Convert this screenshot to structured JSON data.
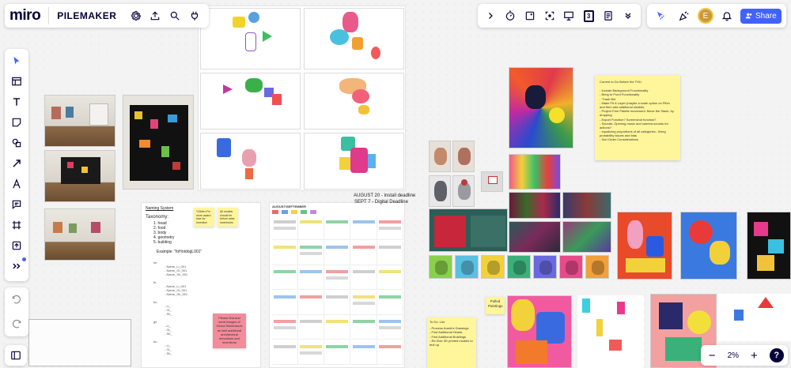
{
  "app": {
    "logo": "miro",
    "board_name": "PILEMAKER",
    "share_label": "Share",
    "avatar_initial": "E",
    "zoom": "2%",
    "help": "?",
    "counter_badge": "3"
  },
  "colors": {
    "accent": "#4262ff",
    "sticky_yellow": "#fff59b",
    "sticky_pink": "#f28b9a",
    "sticky_light": "#fffbe0"
  },
  "icons": {
    "top_left": [
      "gear-icon",
      "upload-icon",
      "search-icon",
      "plug-icon"
    ],
    "top_right": [
      "chevron-right-icon",
      "timer-icon",
      "sticky-icon",
      "focus-icon",
      "present-icon",
      "counter-icon",
      "notes-icon",
      "chevrons-down-icon"
    ],
    "collab": [
      "reaction-icon",
      "celebrate-icon",
      "bell-icon"
    ],
    "left_tools": [
      "select-icon",
      "table-icon",
      "text-icon",
      "sticky-note-icon",
      "shapes-icon",
      "arrow-icon",
      "pen-icon",
      "comment-icon",
      "frame-icon",
      "upload-icon",
      "more-icon"
    ]
  },
  "board": {
    "naming": {
      "title": "Naming System",
      "taxonomy_label": "Taxonomy:",
      "items": [
        "1. head",
        "2. food",
        "3. body",
        "4. geometry",
        "5. building"
      ],
      "example": "Example:  \"foHotdogL001\"",
      "groups": [
        {
          "code": "he",
          "lines": [
            "Name_Li_001",
            "Name_Gi_001",
            "Name_Sh_001"
          ]
        },
        {
          "code": "fo",
          "lines": [
            "Name_Li_001",
            "Name_Gi_001",
            "Name_Sh_001"
          ]
        },
        {
          "code": "bo",
          "lines": [
            "Li_",
            "Gi_",
            "Sh_"
          ]
        },
        {
          "code": "ge",
          "lines": [
            "Li_",
            "Gi_",
            "Sh_"
          ]
        },
        {
          "code": "bu",
          "lines": [
            "Li_",
            "Gi_",
            "Sh_"
          ]
        }
      ],
      "sticky_a": "*Gibber-Fin more award time for Inventive",
      "sticky_b": "All models should be before artist inventories",
      "sticky_pink": "Please find and send images of Gema Sketchbook as well additional architectural elevations and inventions"
    },
    "calendar": {
      "header": "AUGUST/SEPTEMBER",
      "deadline_1": "AUGUST 20 - install deadline",
      "deadline_2": "SEPT 7 - Digital Deadline"
    },
    "sticky_current": {
      "title": "Current to Do Before the THU",
      "lines": [
        "- Include Background Functionality",
        "- Bring to Front Functionality",
        "- 'Trash Bin'",
        "- Make Pit & Layer (maybe a scale option on Pitch and then add additional sizable)",
        "- Project Free Palette movement: Move the Stack, by dropping",
        "- Export Function? Screenshot function?",
        "- Sounds: Opening music and camera sounds for actions?",
        "- equalizing proportions of all categories - fixing probability issues and bias",
        "- Sort Order Considerations"
      ]
    },
    "sticky_pulled": "Pulled Paintings",
    "sticky_todo": {
      "title": "To Do: List",
      "lines": [
        "- Process Austin's Drawings",
        "- Find Additional Heads",
        "- Find Additional Buildings",
        "- Re-Size 3D printed models to text up"
      ]
    }
  }
}
